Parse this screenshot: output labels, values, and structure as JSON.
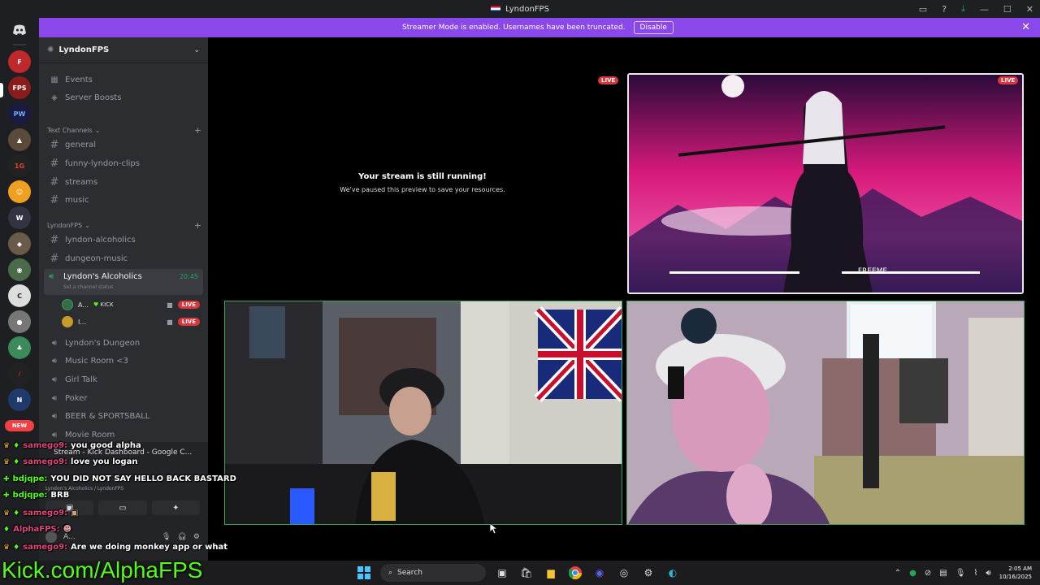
{
  "window": {
    "title": "LyndonFPS"
  },
  "banner": {
    "text": "Streamer Mode is enabled. Usernames have been truncated.",
    "button": "Disable"
  },
  "server": {
    "name": "LyndonFPS",
    "top_items": [
      "Events",
      "Server Boosts"
    ]
  },
  "categories": {
    "text_channels": "Text Channels",
    "lyndonfps": "LyndonFPS"
  },
  "text_channels": [
    "general",
    "funny-lyndon-clips",
    "streams",
    "music"
  ],
  "lyndon_channels": [
    "lyndon-alcoholics",
    "dungeon-music"
  ],
  "active_voice": {
    "name": "Lyndon's Alcoholics",
    "time": "20:45",
    "status": "Set a channel status"
  },
  "voice_users": [
    {
      "name": "A...",
      "tag": "KICK",
      "live": "LIVE"
    },
    {
      "name": "I...",
      "tag": "",
      "live": "LIVE"
    }
  ],
  "voice_channels": [
    "Lyndon's Dungeon",
    "Music Room <3",
    "Girl Talk",
    "Poker",
    "BEER & SPORTSBALL",
    "Movie Room"
  ],
  "rail": {
    "new_badge": "NEW"
  },
  "paused": {
    "heading": "Your stream is still running!",
    "sub": "We've paused this preview to save your resources."
  },
  "live_label": "LIVE",
  "stream_art": {
    "logo": "FREEME"
  },
  "chat": [
    {
      "user": "samego9:",
      "text": "you good alpha"
    },
    {
      "user": "samego9:",
      "text": "love you logan"
    },
    {
      "user": "bdjqpe:",
      "text": "YOU DID NOT SAY HELLO BACK BASTARD"
    },
    {
      "user": "bdjqpe:",
      "text": "BRB"
    },
    {
      "user": "samego9:",
      "text": ""
    },
    {
      "user": "AlphaFPS:",
      "text": ""
    },
    {
      "user": "samego9:",
      "text": "Are we doing monkey app or what"
    }
  ],
  "overlay": {
    "tooltip": "Stream - Kick Dashboard - Google C...",
    "voice_path": "Lyndon's Alcoholics / LyndonFPS",
    "user_short": "A..."
  },
  "kick_link": "Kick.com/AlphaFPS",
  "taskbar": {
    "search": "Search",
    "time": "2:05 AM",
    "date": "10/16/2025"
  }
}
